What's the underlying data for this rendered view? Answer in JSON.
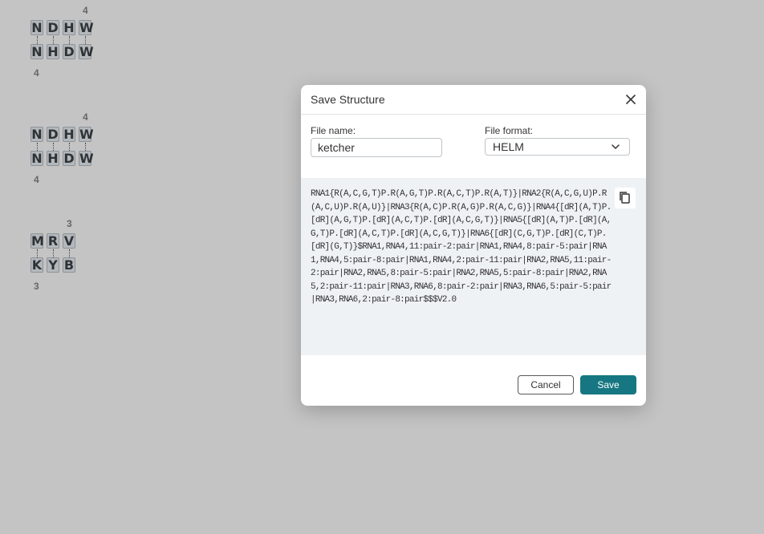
{
  "canvas": {
    "groups": [
      {
        "top_count": "4",
        "bottom_count": "4",
        "top_sequence": [
          "N",
          "D",
          "H",
          "W"
        ],
        "bottom_sequence": [
          "N",
          "H",
          "D",
          "W"
        ]
      },
      {
        "top_count": "4",
        "bottom_count": "4",
        "top_sequence": [
          "N",
          "D",
          "H",
          "W"
        ],
        "bottom_sequence": [
          "N",
          "H",
          "D",
          "W"
        ]
      },
      {
        "top_count": "3",
        "bottom_count": "3",
        "top_sequence": [
          "M",
          "R",
          "V"
        ],
        "bottom_sequence": [
          "K",
          "Y",
          "B"
        ]
      }
    ]
  },
  "dialog": {
    "title": "Save Structure",
    "file_name_label": "File name:",
    "file_name_value": "ketcher",
    "file_format_label": "File format:",
    "file_format_value": "HELM",
    "preview_text": "RNA1{R(A,C,G,T)P.R(A,G,T)P.R(A,C,T)P.R(A,T)}|RNA2{R(A,C,G,U)P.R(A,C,U)P.R(A,U)}|RNA3{R(A,C)P.R(A,G)P.R(A,C,G)}|RNA4{[dR](A,T)P.[dR](A,G,T)P.[dR](A,C,T)P.[dR](A,C,G,T)}|RNA5{[dR](A,T)P.[dR](A,G,T)P.[dR](A,C,T)P.[dR](A,C,G,T)}|RNA6{[dR](C,G,T)P.[dR](C,T)P.[dR](G,T)}$RNA1,RNA4,11:pair-2:pair|RNA1,RNA4,8:pair-5:pair|RNA1,RNA4,5:pair-8:pair|RNA1,RNA4,2:pair-11:pair|RNA2,RNA5,11:pair-2:pair|RNA2,RNA5,8:pair-5:pair|RNA2,RNA5,5:pair-8:pair|RNA2,RNA5,2:pair-11:pair|RNA3,RNA6,8:pair-2:pair|RNA3,RNA6,5:pair-5:pair|RNA3,RNA6,2:pair-8:pair$$$V2.0",
    "cancel_label": "Cancel",
    "save_label": "Save"
  },
  "colors": {
    "accent": "#167782",
    "canvas_bg": "#c4c4c4",
    "preview_bg": "#eff2f5"
  },
  "icons": {
    "close": "close-icon",
    "chevron": "chevron-down-icon",
    "copy": "copy-icon"
  }
}
